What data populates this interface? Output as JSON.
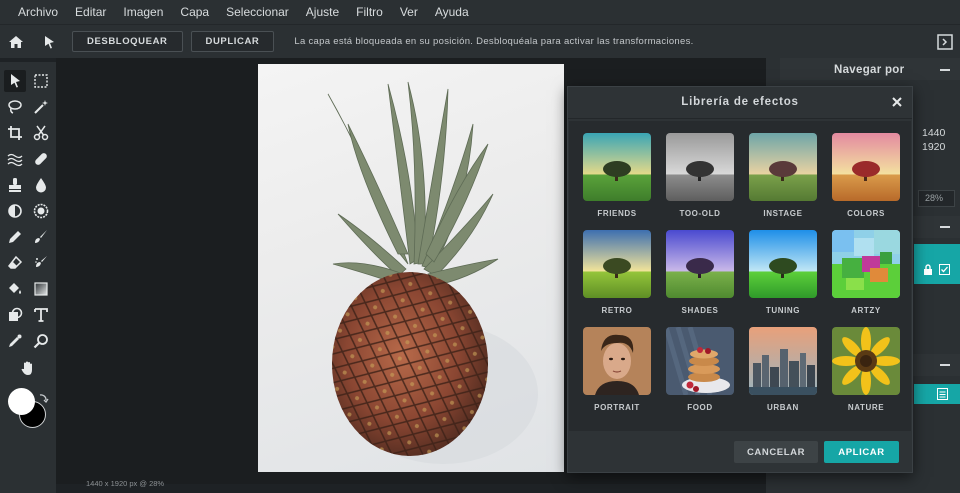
{
  "menu": [
    "Archivo",
    "Editar",
    "Imagen",
    "Capa",
    "Seleccionar",
    "Ajuste",
    "Filtro",
    "Ver",
    "Ayuda"
  ],
  "toolbar": {
    "unlock_label": "DESBLOQUEAR",
    "duplicate_label": "DUPLICAR",
    "message": "La capa está bloqueada en su posición. Desbloquéala para activar las transformaciones."
  },
  "right_panel": {
    "navigator_title": "Navegar por",
    "width_value": "1440",
    "height_value": "1920",
    "zoom_value": "28%"
  },
  "status_bar": "1440 x 1920 px @ 28%",
  "dialog": {
    "title": "Librería de efectos",
    "effects": [
      {
        "name": "FRIENDS"
      },
      {
        "name": "TOO-OLD"
      },
      {
        "name": "INSTAGE"
      },
      {
        "name": "COLORS"
      },
      {
        "name": "RETRO"
      },
      {
        "name": "SHADES"
      },
      {
        "name": "TUNING"
      },
      {
        "name": "ARTZY"
      },
      {
        "name": "PORTRAIT"
      },
      {
        "name": "FOOD"
      },
      {
        "name": "URBAN"
      },
      {
        "name": "NATURE"
      }
    ],
    "cancel_label": "CANCELAR",
    "apply_label": "APLICAR"
  },
  "colors": {
    "accent": "#16a6a6",
    "foreground_color": "#ffffff",
    "background_color": "#000000"
  }
}
